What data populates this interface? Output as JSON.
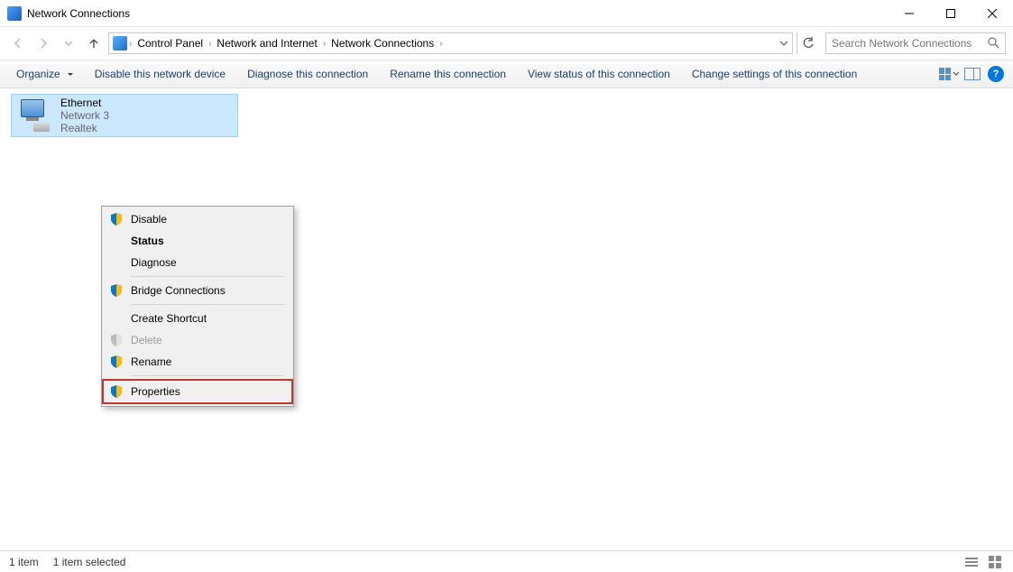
{
  "titlebar": {
    "title": "Network Connections"
  },
  "breadcrumb": {
    "items": [
      "Control Panel",
      "Network and Internet",
      "Network Connections"
    ]
  },
  "search": {
    "placeholder": "Search Network Connections"
  },
  "toolbar": {
    "organize": "Organize",
    "disable": "Disable this network device",
    "diagnose": "Diagnose this connection",
    "rename": "Rename this connection",
    "view_status": "View status of this connection",
    "change_settings": "Change settings of this connection"
  },
  "adapter": {
    "name": "Ethernet",
    "network": "Network  3",
    "device": "Realtek"
  },
  "context_menu": {
    "disable": "Disable",
    "status": "Status",
    "diagnose": "Diagnose",
    "bridge": "Bridge Connections",
    "create_shortcut": "Create Shortcut",
    "delete": "Delete",
    "rename": "Rename",
    "properties": "Properties"
  },
  "statusbar": {
    "count": "1 item",
    "selected": "1 item selected"
  }
}
